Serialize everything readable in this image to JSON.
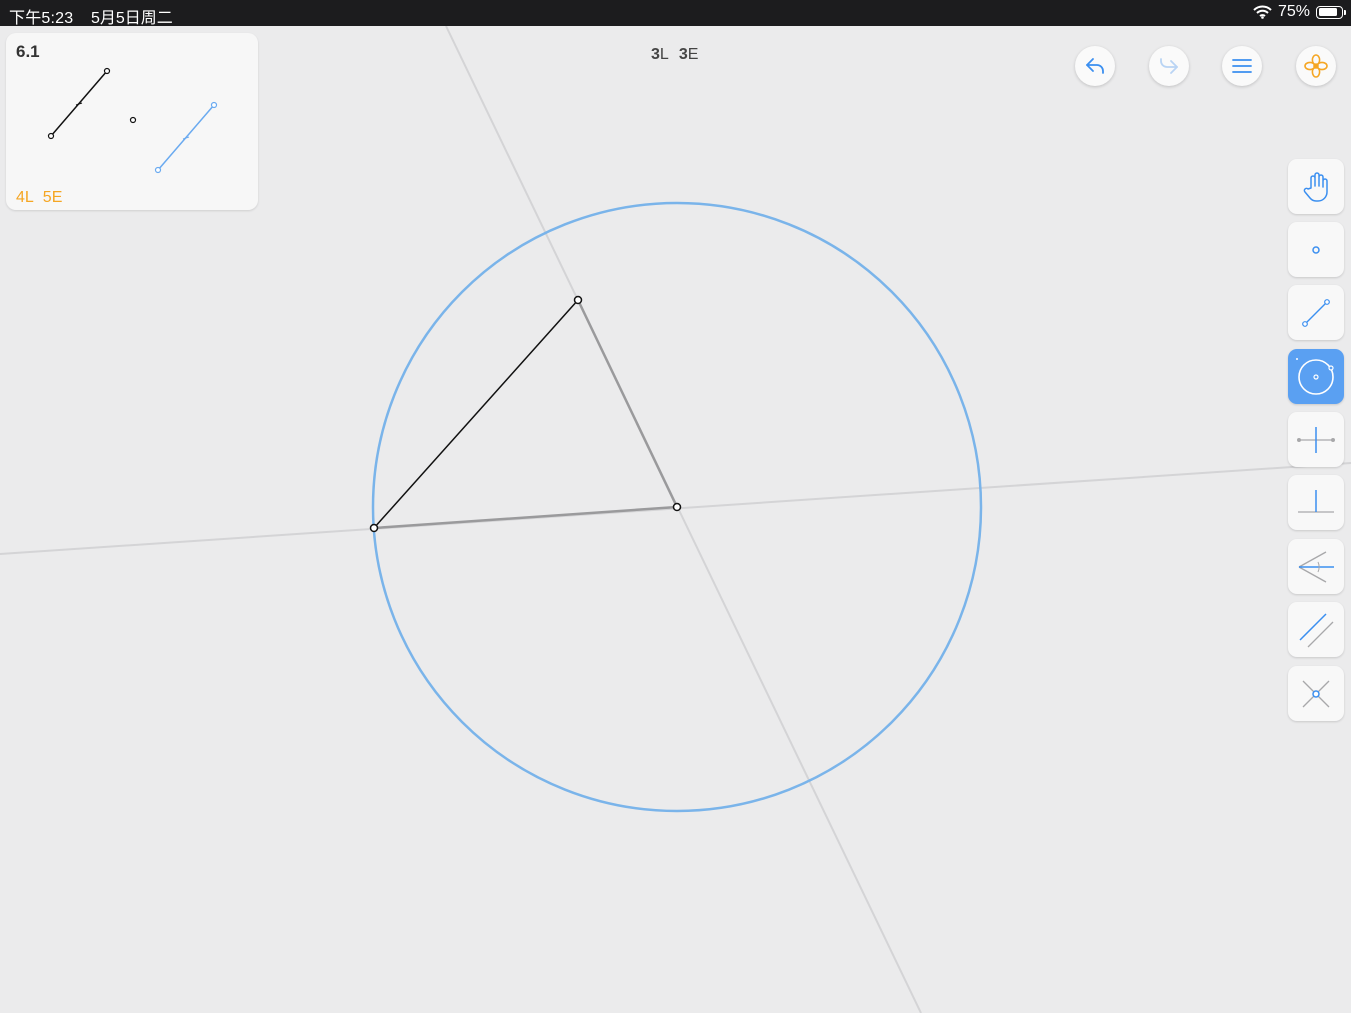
{
  "status_bar": {
    "time": "下午5:23",
    "date": "5月5日周二",
    "battery": "75%"
  },
  "level": {
    "number": "6.1",
    "goal_l": "4L",
    "goal_e": "5E"
  },
  "score": {
    "l_count": "3",
    "l_suffix": "L",
    "e_count": "3",
    "e_suffix": "E"
  },
  "toolbar_top": [
    {
      "icon": "undo-icon",
      "enabled": true
    },
    {
      "icon": "redo-icon",
      "enabled": false
    },
    {
      "icon": "menu-icon",
      "enabled": true
    },
    {
      "icon": "hint-flower-icon",
      "enabled": true
    }
  ],
  "tools": [
    {
      "icon": "hand-icon",
      "active": false
    },
    {
      "icon": "point-icon",
      "active": false
    },
    {
      "icon": "line-icon",
      "active": false
    },
    {
      "icon": "circle-icon",
      "active": true
    },
    {
      "icon": "perpendicular-bisector-icon",
      "active": false
    },
    {
      "icon": "perpendicular-icon",
      "active": false
    },
    {
      "icon": "angle-bisector-icon",
      "active": false
    },
    {
      "icon": "parallel-icon",
      "active": false
    },
    {
      "icon": "intersection-icon",
      "active": false
    }
  ],
  "colors": {
    "accent": "#5aa0f2",
    "goal": "#f5a623",
    "construction": "#7ab4ea"
  }
}
